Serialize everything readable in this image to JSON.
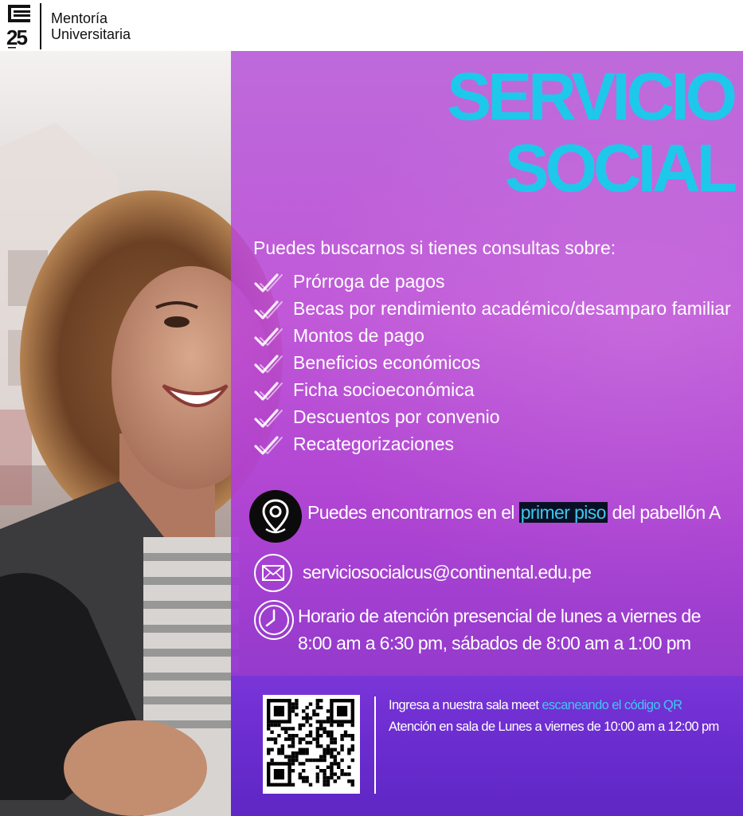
{
  "header": {
    "logo_number": "25",
    "logo_line1": "Mentoría",
    "logo_line2": "Universitaria"
  },
  "title": {
    "line1": "SERVICIO",
    "line2": "SOCIAL"
  },
  "intro": "Puedes buscarnos si tienes consultas sobre:",
  "items": [
    "Prórroga de pagos",
    "Becas por rendimiento académico/desamparo familiar",
    "Montos de pago",
    "Beneficios económicos",
    "Ficha socioeconómica",
    "Descuentos por convenio",
    "Recategorizaciones"
  ],
  "location": {
    "before": "Puedes encontrarnos en el",
    "highlight": "primer piso",
    "after": "del pabellón A"
  },
  "email": "serviciosocialcus@continental.edu.pe",
  "hours": "Horario de atención presencial de lunes a viernes de 8:00 am a 6:30 pm, sábados de 8:00 am a 1:00 pm",
  "meet": {
    "text": "Ingresa a nuestra sala meet",
    "link": "escaneando el código QR",
    "schedule": "Atención en sala de Lunes a viernes de 10:00 am a 12:00 pm"
  },
  "colors": {
    "title": "#1ec8ea",
    "panel": "#b048d6",
    "panel_bottom": "#6a2ccf",
    "highlight_bg": "#0a1024",
    "link": "#3ec7f0"
  },
  "icons": [
    "check-icon",
    "location-pin-icon",
    "mail-icon",
    "clock-icon",
    "qr-code"
  ]
}
